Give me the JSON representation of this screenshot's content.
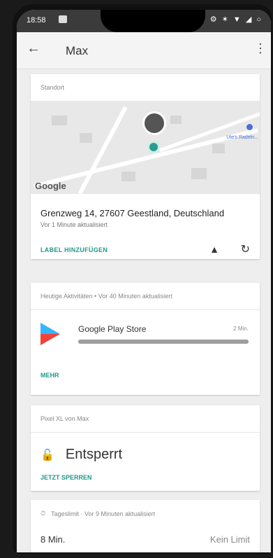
{
  "status_bar": {
    "time": "18:58",
    "icons": "⚙ ✶ ▼ ◢ ○"
  },
  "app_bar": {
    "title": "Max",
    "back_icon": "←",
    "menu_icon": "⋮"
  },
  "location_card": {
    "header": "Standort",
    "map": {
      "watermark": "Google",
      "poi_label": "Ute's Radeln..."
    },
    "address": "Grenzweg 14, 27607 Geestland, Deutschland",
    "updated": "Vor 1 Minute aktualisiert",
    "action_label": "LABEL HINZUFÜGEN",
    "navigate_icon": "▲",
    "refresh_icon": "↻"
  },
  "activity_card": {
    "header": "Heutige Aktivitäten • Vor 40 Minuten aktualisiert",
    "app": {
      "name": "Google Play Store",
      "time": "2 Min.",
      "usage_fraction": 1.0
    },
    "more_label": "MEHR"
  },
  "device_card": {
    "header": "Pixel XL von Max",
    "status": "Entsperrt",
    "action_label": "JETZT SPERREN",
    "lock_icon": "🔓"
  },
  "limit_card": {
    "header": "Tageslimit · Vor 9 Minuten aktualisiert",
    "used": "8 Min.",
    "limit": "Kein Limit",
    "clock_icon": "⏱"
  }
}
